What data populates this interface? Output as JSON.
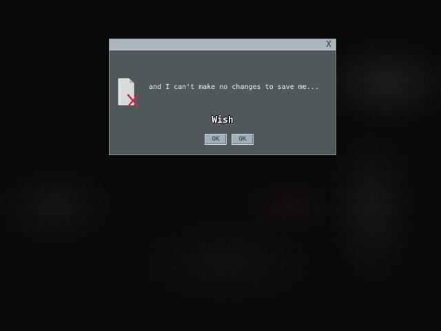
{
  "dialog": {
    "close_label": "X",
    "icon": "file-error-icon",
    "message": "and I can't make no changes to save me...",
    "emphasis": "Wish",
    "buttons": [
      {
        "label": "OK"
      },
      {
        "label": "OK"
      }
    ]
  },
  "colors": {
    "background": "#050505",
    "dialog_body": "#4f595c",
    "titlebar": "#a9b7bd",
    "button": "#9fb0b8",
    "icon_x": "#c0324a"
  }
}
